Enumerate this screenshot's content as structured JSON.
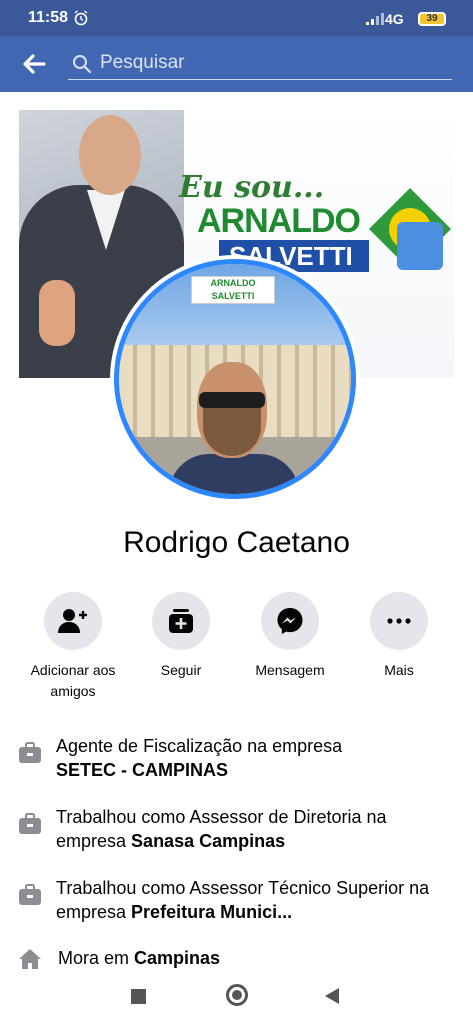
{
  "status_bar": {
    "time": "11:58",
    "network": "4G",
    "battery": "39"
  },
  "search": {
    "placeholder": "Pesquisar"
  },
  "cover": {
    "line1": "Eu sou...",
    "line2": "ARNALDO",
    "line3": "SALVETTI",
    "banner": "ARNALDO SALVETTI"
  },
  "profile": {
    "name": "Rodrigo Caetano"
  },
  "actions": [
    {
      "label": "Adicionar aos amigos",
      "icon": "add-friend-icon"
    },
    {
      "label": "Seguir",
      "icon": "follow-icon"
    },
    {
      "label": "Mensagem",
      "icon": "messenger-icon"
    },
    {
      "label": "Mais",
      "icon": "more-icon"
    }
  ],
  "info": [
    {
      "icon": "briefcase-icon",
      "prefix": "Agente de Fiscalização na empresa",
      "bold": "SETEC - CAMPINAS"
    },
    {
      "icon": "briefcase-icon",
      "prefix": "Trabalhou como Assessor de Diretoria na empresa",
      "bold": "Sanasa Campinas"
    },
    {
      "icon": "briefcase-icon",
      "prefix": "Trabalhou como Assessor Técnico Superior na empresa",
      "bold": "Prefeitura Munici..."
    },
    {
      "icon": "home-icon",
      "prefix": "Mora em",
      "bold": "Campinas"
    }
  ],
  "colors": {
    "header": "#4267b2",
    "accent": "#2d88ff",
    "button_bg": "#e4e6eb"
  }
}
